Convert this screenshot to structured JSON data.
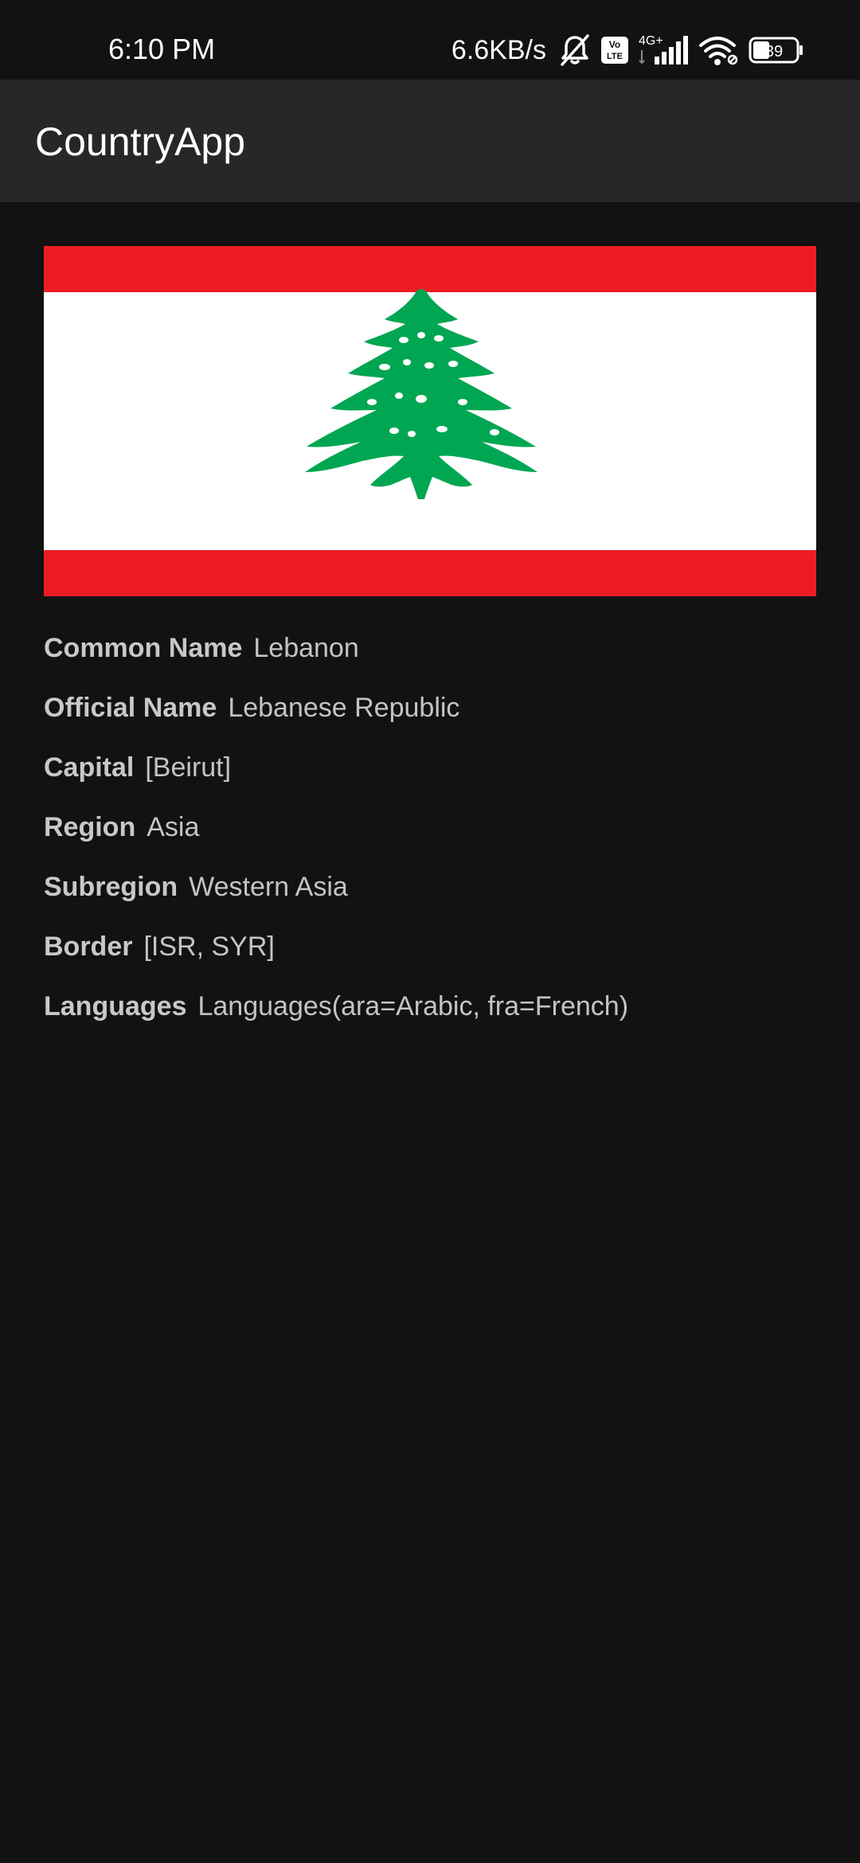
{
  "status_bar": {
    "time": "6:10 PM",
    "net_speed": "6.6KB/s",
    "network_type": "4G+",
    "volte_label_top": "Vo",
    "volte_label_bottom": "LTE",
    "battery_level": "39",
    "icons": [
      "bell-muted-icon",
      "volte-icon",
      "signal-icon",
      "wifi-icon",
      "battery-icon"
    ]
  },
  "app_bar": {
    "title": "CountryApp"
  },
  "flag": {
    "country": "Lebanon",
    "colors": {
      "red": "#ED1C24",
      "white": "#FFFFFF",
      "green": "#00A651"
    }
  },
  "details": [
    {
      "label": "Common Name",
      "value": "Lebanon"
    },
    {
      "label": "Official Name",
      "value": "Lebanese Republic"
    },
    {
      "label": "Capital",
      "value": "[Beirut]"
    },
    {
      "label": "Region",
      "value": "Asia"
    },
    {
      "label": "Subregion",
      "value": "Western Asia"
    },
    {
      "label": "Border",
      "value": "[ISR, SYR]"
    },
    {
      "label": "Languages",
      "value": "Languages(ara=Arabic, fra=French)"
    }
  ],
  "theme": {
    "background": "#121212",
    "app_bar": "#272727",
    "text": "#C8C8C8"
  }
}
